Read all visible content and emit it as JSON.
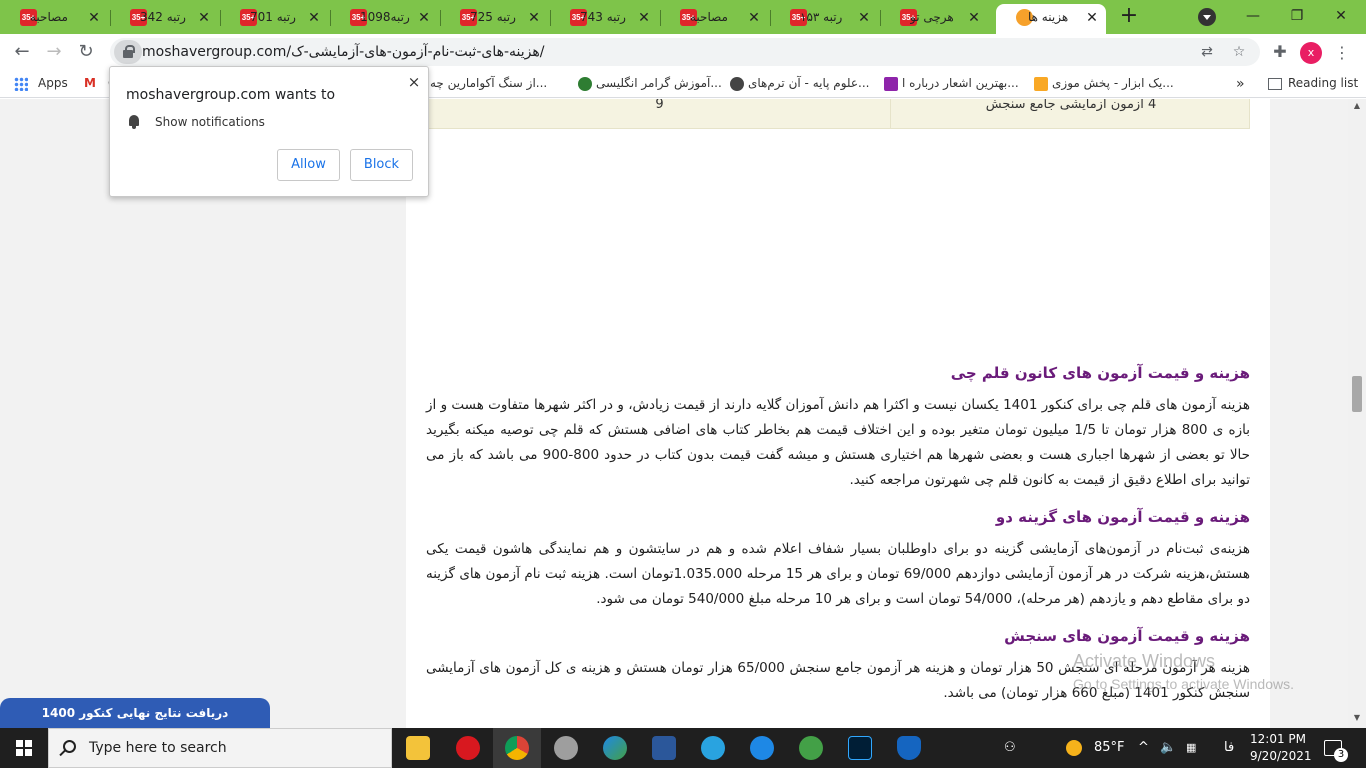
{
  "tabs": [
    {
      "title": "مصاحبه",
      "favicon": "+35"
    },
    {
      "title": "رتبه 342",
      "favicon": "+35"
    },
    {
      "title": "رتبه 701",
      "favicon": "+35"
    },
    {
      "title": "رتبه1098",
      "favicon": "+35"
    },
    {
      "title": "رتبه 725",
      "favicon": "+35"
    },
    {
      "title": "رتبه 743",
      "favicon": "+35"
    },
    {
      "title": "مصاحبه",
      "favicon": "+35"
    },
    {
      "title": "رتبه ۱۵۳",
      "favicon": "+35"
    },
    {
      "title": "هرچی تو",
      "favicon": "+35"
    },
    {
      "title": "هزینه ها",
      "favicon": "",
      "active": true
    }
  ],
  "new_tab_label": "+",
  "window_controls": {
    "minimize": "—",
    "maximize": "❐",
    "close": "✕"
  },
  "toolbar": {
    "url": "moshavergroup.com/هزینه-های-ثبت-نام-آزمون-های-آزمایشی-ک/",
    "profile_initial": "x"
  },
  "bookmarks": [
    {
      "label": "Apps"
    },
    {
      "label": "G"
    },
    {
      "label": "از سنگ آکوامارین چه..."
    },
    {
      "label": "آموزش گرامر انگلیسی..."
    },
    {
      "label": "علوم پایه - آن ترم‌های..."
    },
    {
      "label": "بهترین اشعار درباره ا..."
    },
    {
      "label": "یک ابزار - پخش موزی..."
    }
  ],
  "bookmarks_more": "»",
  "reading_list": "Reading list",
  "table_row": {
    "count": "9",
    "label": "4 آزمون آزمایشی جامع سنجش"
  },
  "article": [
    {
      "heading": "هزینه و قیمت آزمون های کانون قلم چی",
      "body": "هزینه آزمون های قلم چی برای کنکور 1401 یکسان نیست و اکثرا هم دانش آموزان گلایه دارند از قیمت زیادش، و در اکثر شهرها متفاوت هست و از بازه ی 800 هزار تومان تا 1/5 میلیون تومان متغیر بوده و این اختلاف قیمت هم بخاطر کتاب های اضافی هستش که قلم چی توصیه میکنه بگیرید حالا تو بعضی از شهرها اجباری هست و بعضی شهرها هم اختیاری هستش و میشه گفت قیمت بدون کتاب در حدود 800-900 می باشد که باز می توانید برای اطلاع دقیق از قیمت به کانون قلم چی شهرتون مراجعه کنید."
    },
    {
      "heading": "هزینه و قیمت آزمون های گزینه دو",
      "body": "هزینه‌ی ثبت‌نام در آزمون‌های آزمایشی گزینه دو برای داوطلبان بسیار شفاف اعلام شده و هم در سایتشون و هم نمایندگی هاشون قیمت یکی هستش،هزینه شرکت در هر آزمون آزمایشی دوازدهم 69/000 تومان و برای هر 15 مرحله 1.035.000تومان است. هزینه ثبت نام آزمون های گزینه دو برای مقاطع دهم و یازدهم (هر مرحله)، 54/000 تومان است و برای هر 10 مرحله مبلغ 540/000 تومان می شود."
    },
    {
      "heading": "هزینه و قیمت آزمون های سنجش",
      "body": "هزینه هر آزمون مرحله ای سنجش 50 هزار تومان و هزینه هر آزمون جامع سنجش 65/000 هزار تومان هستش و هزینه ی کل آزمون های آزمایشی سنجش کنکور 1401 (مبلغ 660 هزار تومان) می باشد."
    }
  ],
  "popup": {
    "title": "moshavergroup.com wants to",
    "permission": "Show notifications",
    "allow": "Allow",
    "block": "Block",
    "close": "×"
  },
  "watermark": {
    "line1": "Activate Windows",
    "line2": "Go to Settings to activate Windows."
  },
  "float_banner": "دریافت نتایج نهایی کنکور 1400",
  "taskbar": {
    "search_placeholder": "Type here to search",
    "weather": "85°F",
    "language": "فا",
    "time": "12:01 PM",
    "date": "9/20/2021",
    "notification_count": "3"
  },
  "colors": {
    "tab_strip": "#7ec44a",
    "heading": "#6a1b7a",
    "banner": "#2f5cb5",
    "table_bg": "#f5f3e1"
  }
}
